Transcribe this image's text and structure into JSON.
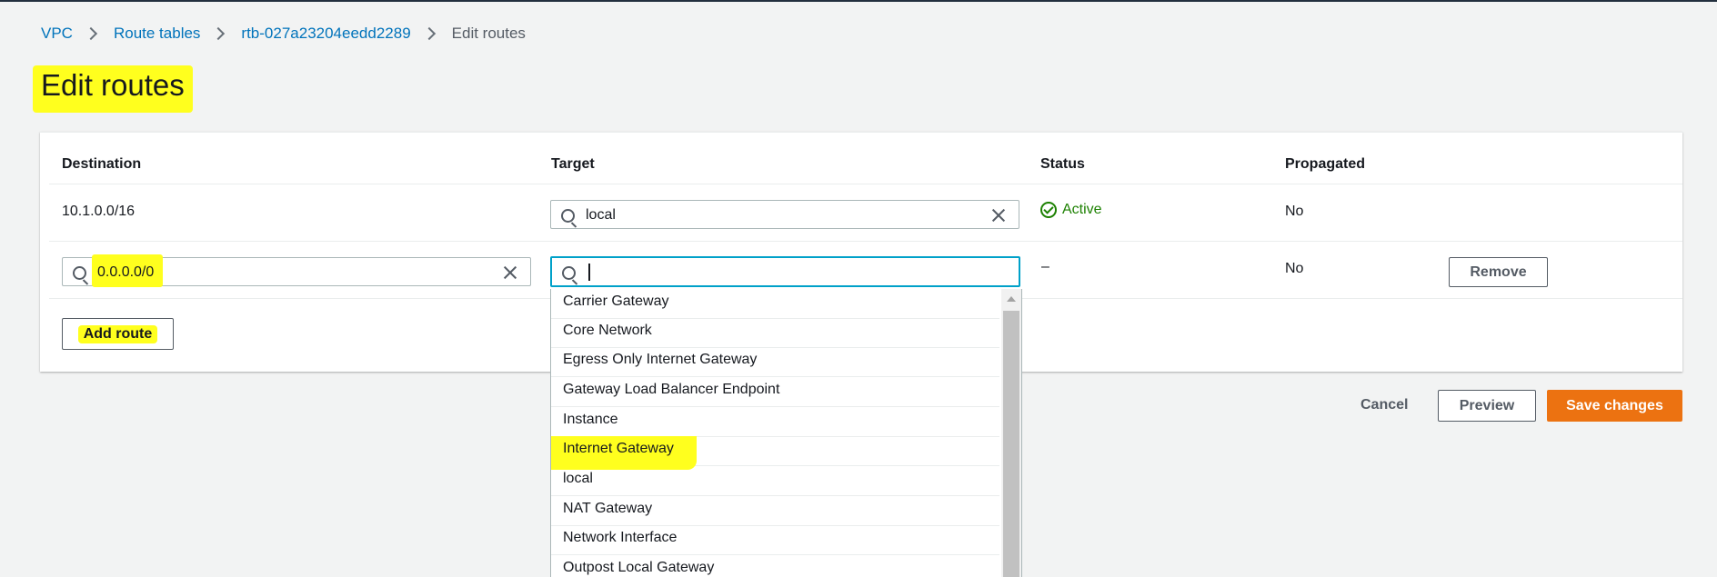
{
  "breadcrumb": {
    "items": [
      "VPC",
      "Route tables",
      "rtb-027a23204eedd2289"
    ],
    "current": "Edit routes"
  },
  "page": {
    "title": "Edit routes"
  },
  "table": {
    "headers": {
      "destination": "Destination",
      "target": "Target",
      "status": "Status",
      "propagated": "Propagated"
    },
    "rows": [
      {
        "destination": "10.1.0.0/16",
        "target": "local",
        "status": "Active",
        "propagated": "No"
      },
      {
        "destination": "0.0.0.0/0",
        "target": "",
        "status": "–",
        "propagated": "No",
        "remove_label": "Remove"
      }
    ]
  },
  "buttons": {
    "add_route": "Add route",
    "cancel": "Cancel",
    "preview": "Preview",
    "save": "Save changes"
  },
  "dropdown": {
    "options": [
      "Carrier Gateway",
      "Core Network",
      "Egress Only Internet Gateway",
      "Gateway Load Balancer Endpoint",
      "Instance",
      "Internet Gateway",
      "local",
      "NAT Gateway",
      "Network Interface",
      "Outpost Local Gateway"
    ],
    "highlighted": "Internet Gateway"
  },
  "colors": {
    "link": "#0073bb",
    "primary": "#ec7211",
    "success": "#1d8102",
    "focus": "#00a1c9",
    "highlight": "#ffff1e"
  },
  "icons": [
    "chevron-right-icon",
    "search-icon",
    "clear-icon",
    "check-circle-icon"
  ]
}
